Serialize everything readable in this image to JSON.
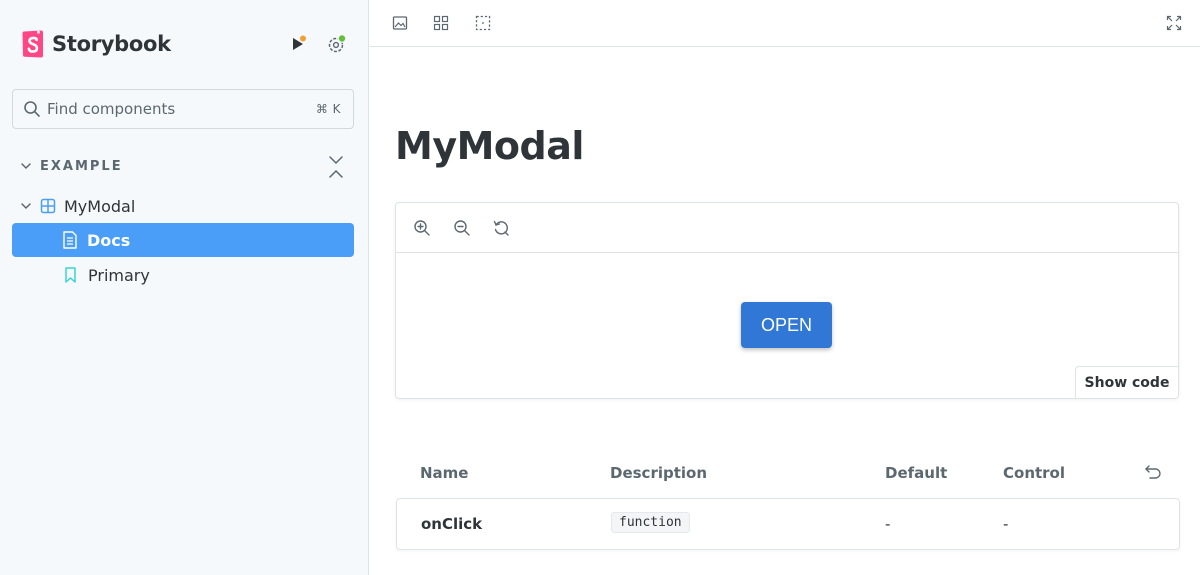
{
  "sidebar": {
    "brand": "Storybook",
    "icons": {
      "play": "play-icon",
      "settings": "settings-gear-icon"
    },
    "search": {
      "placeholder": "Find components",
      "shortcut": "⌘ K"
    },
    "group": {
      "label": "EXAMPLE"
    },
    "tree": {
      "component": "MyModal",
      "docs": "Docs",
      "story": "Primary"
    }
  },
  "toolbar": {
    "icons": [
      "image-icon",
      "grid-icon",
      "outline-icon",
      "fullscreen-icon"
    ]
  },
  "main": {
    "title": "MyModal",
    "preview": {
      "icons": [
        "zoom-in-icon",
        "zoom-out-icon",
        "reset-zoom-icon"
      ],
      "open_button": "OPEN",
      "show_code": "Show code"
    },
    "args_table": {
      "headers": {
        "name": "Name",
        "description": "Description",
        "default": "Default",
        "control": "Control"
      },
      "rows": [
        {
          "name": "onClick",
          "type": "function",
          "default": "-",
          "control": "-"
        }
      ]
    }
  },
  "colors": {
    "brand_pink": "#ff4785",
    "selected_blue": "#4a9ef8",
    "button_blue": "#3178d6",
    "notify_orange": "#f0a030",
    "notify_green": "#66bf3c"
  }
}
